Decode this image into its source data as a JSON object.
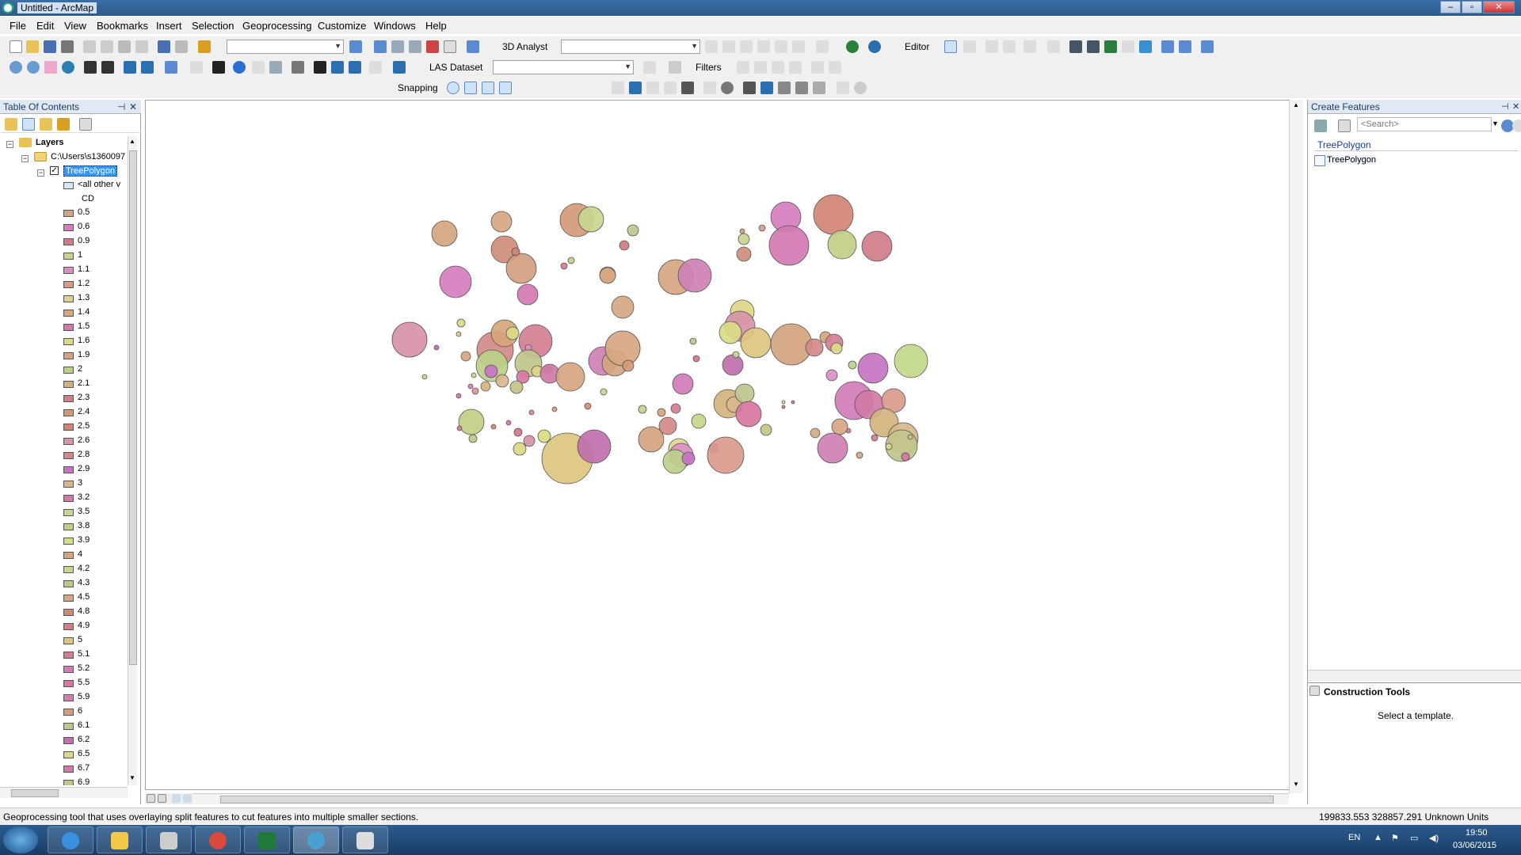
{
  "window": {
    "title": "Untitled - ArcMap"
  },
  "menus": [
    "File",
    "Edit",
    "View",
    "Bookmarks",
    "Insert",
    "Selection",
    "Geoprocessing",
    "Customize",
    "Windows",
    "Help"
  ],
  "toolbars": {
    "analyst_label": "3D Analyst",
    "editor_label": "Editor",
    "las_label": "LAS Dataset",
    "filters_label": "Filters",
    "snapping_label": "Snapping"
  },
  "toc": {
    "title": "Table Of Contents",
    "root_label": "Layers",
    "folder_label": "C:\\Users\\s1360097",
    "layer_label": "TreePolygon",
    "other_values_label": "<all other v",
    "field_label": "CD",
    "classes": [
      {
        "label": "0.5",
        "color": "#d4a57e"
      },
      {
        "label": "0.6",
        "color": "#d57fbe"
      },
      {
        "label": "0.9",
        "color": "#cf7a86"
      },
      {
        "label": "1",
        "color": "#c5d48a"
      },
      {
        "label": "1.1",
        "color": "#dc8fc6"
      },
      {
        "label": "1.2",
        "color": "#d99a8c"
      },
      {
        "label": "1.3",
        "color": "#dcd48e"
      },
      {
        "label": "1.4",
        "color": "#d7a782"
      },
      {
        "label": "1.5",
        "color": "#d178b3"
      },
      {
        "label": "1.6",
        "color": "#dcd783"
      },
      {
        "label": "1.9",
        "color": "#d4a37f"
      },
      {
        "label": "2",
        "color": "#bcd08a"
      },
      {
        "label": "2.1",
        "color": "#d3b37d"
      },
      {
        "label": "2.3",
        "color": "#cf7f8c"
      },
      {
        "label": "2.4",
        "color": "#d49a78"
      },
      {
        "label": "2.5",
        "color": "#d38476"
      },
      {
        "label": "2.6",
        "color": "#d893a8"
      },
      {
        "label": "2.8",
        "color": "#d28a88"
      },
      {
        "label": "2.9",
        "color": "#c774c2"
      },
      {
        "label": "3",
        "color": "#d9b68c"
      },
      {
        "label": "3.2",
        "color": "#cf7aa6"
      },
      {
        "label": "3.5",
        "color": "#c9d590"
      },
      {
        "label": "3.8",
        "color": "#c0cf86"
      },
      {
        "label": "3.9",
        "color": "#d9db84"
      },
      {
        "label": "4",
        "color": "#d6a57b"
      },
      {
        "label": "4.2",
        "color": "#c3d88a"
      },
      {
        "label": "4.3",
        "color": "#c0c58c"
      },
      {
        "label": "4.5",
        "color": "#d6a682"
      },
      {
        "label": "4.8",
        "color": "#cf8d78"
      },
      {
        "label": "4.9",
        "color": "#d07d87"
      },
      {
        "label": "5",
        "color": "#dcc57f"
      },
      {
        "label": "5.1",
        "color": "#d27f92"
      },
      {
        "label": "5.2",
        "color": "#d27cba"
      },
      {
        "label": "5.5",
        "color": "#d8769f"
      },
      {
        "label": "5.9",
        "color": "#cf80b4"
      },
      {
        "label": "6",
        "color": "#d39e80"
      },
      {
        "label": "6.1",
        "color": "#bcc98a"
      },
      {
        "label": "6.2",
        "color": "#c16fae"
      },
      {
        "label": "6.5",
        "color": "#dcd98c"
      },
      {
        "label": "6.7",
        "color": "#d17aa5"
      },
      {
        "label": "6.9",
        "color": "#c3c486"
      }
    ]
  },
  "create_features": {
    "title": "Create Features",
    "search_placeholder": "<Search>",
    "group_label": "TreePolygon",
    "template_label": "TreePolygon",
    "construction_title": "Construction Tools",
    "construction_hint": "Select a template."
  },
  "status": {
    "message": "Geoprocessing tool that uses overlaying split features to cut features into multiple smaller sections.",
    "coordinates": "199833.553  328857.291 Unknown Units"
  },
  "taskbar": {
    "language": "EN",
    "time": "19:50",
    "date": "03/06/2015"
  },
  "colors": {
    "accent": "#3399ff",
    "panel_header": "#dfe8f3",
    "titlebar": "#2b5a8c"
  }
}
